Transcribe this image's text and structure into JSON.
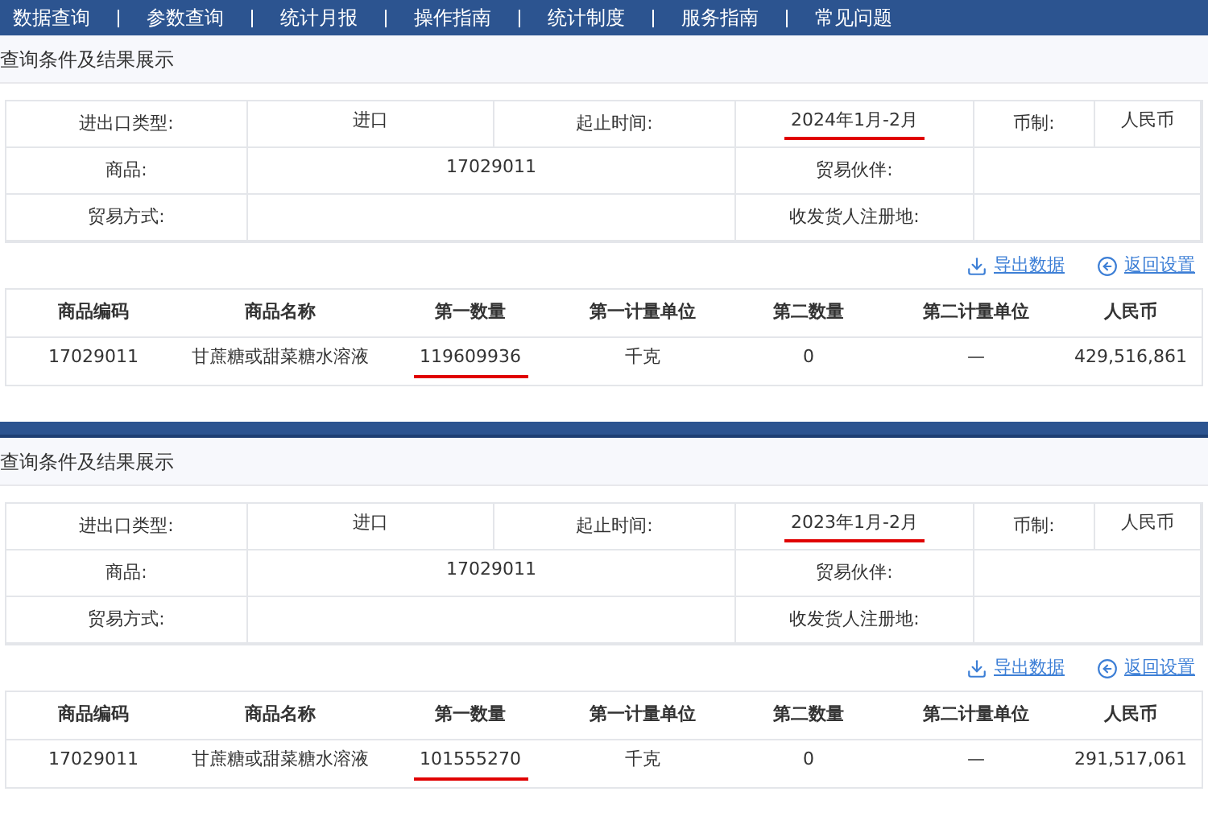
{
  "nav_bar": {
    "items": [
      "数据查询",
      "参数查询",
      "统计月报",
      "操作指南",
      "统计制度",
      "服务指南",
      "常见问题"
    ]
  },
  "panels": [
    {
      "heading": "查询条件及结果展示",
      "criteria": [
        {
          "pairs": [
            {
              "label": "进出口类型:",
              "value": "进口",
              "underlined": false
            },
            {
              "label": "起止时间:",
              "value": "2024年1月-2月",
              "underlined": true
            },
            {
              "label": "币制:",
              "value": "人民币",
              "underlined": false
            }
          ]
        },
        {
          "pairs": [
            {
              "label": "商品:",
              "value": "17029011",
              "underlined": false
            },
            {
              "label": "贸易伙伴:"
            }
          ]
        },
        {
          "pairs": [
            {
              "label": "贸易方式:"
            },
            {
              "label": "收发货人注册地:"
            }
          ]
        }
      ],
      "links": [
        {
          "kind": "export",
          "label": "导出数据"
        },
        {
          "kind": "back",
          "label": "返回设置"
        }
      ],
      "results": {
        "columns": [
          "商品编码",
          "商品名称",
          "第一数量",
          "第一计量单位",
          "第二数量",
          "第二计量单位",
          "人民币"
        ],
        "rows": [
          {
            "cells": [
              {
                "text": "17029011",
                "underlined": false
              },
              {
                "text": "甘蔗糖或甜菜糖水溶液",
                "underlined": false
              },
              {
                "text": "119609936",
                "underlined": true
              },
              {
                "text": "千克",
                "underlined": false
              },
              {
                "text": "0",
                "underlined": false
              },
              {
                "text": "—",
                "underlined": false
              },
              {
                "text": "429,516,861",
                "underlined": false
              }
            ]
          }
        ]
      }
    },
    {
      "heading": "查询条件及结果展示",
      "criteria": [
        {
          "pairs": [
            {
              "label": "进出口类型:",
              "value": "进口",
              "underlined": false
            },
            {
              "label": "起止时间:",
              "value": "2023年1月-2月",
              "underlined": true
            },
            {
              "label": "币制:",
              "value": "人民币",
              "underlined": false
            }
          ]
        },
        {
          "pairs": [
            {
              "label": "商品:",
              "value": "17029011",
              "underlined": false
            },
            {
              "label": "贸易伙伴:"
            }
          ]
        },
        {
          "pairs": [
            {
              "label": "贸易方式:"
            },
            {
              "label": "收发货人注册地:"
            }
          ]
        }
      ],
      "links": [
        {
          "kind": "export",
          "label": "导出数据"
        },
        {
          "kind": "back",
          "label": "返回设置"
        }
      ],
      "results": {
        "columns": [
          "商品编码",
          "商品名称",
          "第一数量",
          "第一计量单位",
          "第二数量",
          "第二计量单位",
          "人民币"
        ],
        "rows": [
          {
            "cells": [
              {
                "text": "17029011",
                "underlined": false
              },
              {
                "text": "甘蔗糖或甜菜糖水溶液",
                "underlined": false
              },
              {
                "text": "101555270",
                "underlined": true
              },
              {
                "text": "千克",
                "underlined": false
              },
              {
                "text": "0",
                "underlined": false
              },
              {
                "text": "—",
                "underlined": false
              },
              {
                "text": "291,517,061",
                "underlined": false
              }
            ]
          }
        ]
      }
    }
  ]
}
